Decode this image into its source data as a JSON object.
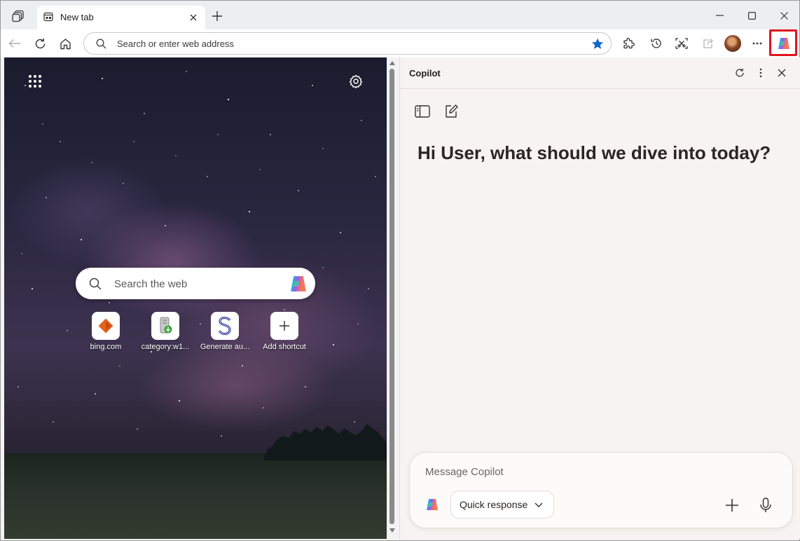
{
  "browser": {
    "tab": {
      "title": "New tab"
    },
    "address_bar": {
      "placeholder": "Search or enter web address"
    }
  },
  "new_tab_page": {
    "search": {
      "placeholder": "Search the web"
    },
    "shortcuts": [
      {
        "label": "bing.com",
        "icon": "bing-icon"
      },
      {
        "label": "category:w1...",
        "icon": "file-download-icon"
      },
      {
        "label": "Generate au...",
        "icon": "s-logo-icon"
      },
      {
        "label": "Add shortcut",
        "icon": "plus-icon"
      }
    ]
  },
  "copilot": {
    "title": "Copilot",
    "greeting": "Hi User, what should we dive into today?",
    "composer": {
      "placeholder": "Message Copilot",
      "mode": "Quick response"
    }
  },
  "colors": {
    "highlight": "#e0121e",
    "favorite_star": "#1266c9"
  }
}
